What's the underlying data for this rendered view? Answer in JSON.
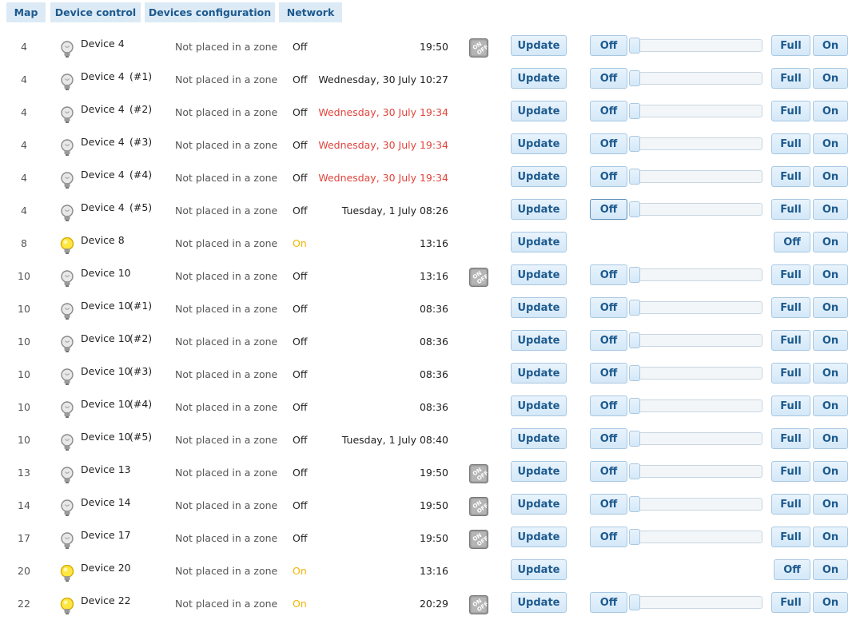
{
  "tabs": [
    "Map",
    "Device control",
    "Devices configuration",
    "Network"
  ],
  "buttons": {
    "update": "Update",
    "off": "Off",
    "full": "Full",
    "on": "On"
  },
  "colors": {
    "accent": "#1d5a8e",
    "tab_bg": "#dceaf6",
    "alert": "#e0453c",
    "on_state": "#f2b400"
  },
  "devices": [
    {
      "id": "4",
      "bulb": "bulb-off-icon",
      "name": "Device 4",
      "suffix": "",
      "zone": "Not placed in a zone",
      "state": "Off",
      "time": "19:50",
      "time_alert": false,
      "onoff_icon": true,
      "controls": "dimmer",
      "off_active": false
    },
    {
      "id": "4",
      "bulb": "bulb-off-icon",
      "name": "Device 4",
      "suffix": "(#1)",
      "zone": "Not placed in a zone",
      "state": "Off",
      "time": "Wednesday, 30 July 10:27",
      "time_alert": false,
      "onoff_icon": false,
      "controls": "dimmer",
      "off_active": false
    },
    {
      "id": "4",
      "bulb": "bulb-off-icon",
      "name": "Device 4",
      "suffix": "(#2)",
      "zone": "Not placed in a zone",
      "state": "Off",
      "time": "Wednesday, 30 July 19:34",
      "time_alert": true,
      "onoff_icon": false,
      "controls": "dimmer",
      "off_active": false
    },
    {
      "id": "4",
      "bulb": "bulb-off-icon",
      "name": "Device 4",
      "suffix": "(#3)",
      "zone": "Not placed in a zone",
      "state": "Off",
      "time": "Wednesday, 30 July 19:34",
      "time_alert": true,
      "onoff_icon": false,
      "controls": "dimmer",
      "off_active": false
    },
    {
      "id": "4",
      "bulb": "bulb-off-icon",
      "name": "Device 4",
      "suffix": "(#4)",
      "zone": "Not placed in a zone",
      "state": "Off",
      "time": "Wednesday, 30 July 19:34",
      "time_alert": true,
      "onoff_icon": false,
      "controls": "dimmer",
      "off_active": false
    },
    {
      "id": "4",
      "bulb": "bulb-off-icon",
      "name": "Device 4",
      "suffix": "(#5)",
      "zone": "Not placed in a zone",
      "state": "Off",
      "time": "Tuesday, 1 July 08:26",
      "time_alert": false,
      "onoff_icon": false,
      "controls": "dimmer",
      "off_active": true
    },
    {
      "id": "8",
      "bulb": "bulb-on-icon",
      "name": "Device 8",
      "suffix": "",
      "zone": "Not placed in a zone",
      "state": "On",
      "time": "13:16",
      "time_alert": false,
      "onoff_icon": false,
      "controls": "switch",
      "off_active": false
    },
    {
      "id": "10",
      "bulb": "bulb-off-icon",
      "name": "Device 10",
      "suffix": "",
      "zone": "Not placed in a zone",
      "state": "Off",
      "time": "13:16",
      "time_alert": false,
      "onoff_icon": true,
      "controls": "dimmer",
      "off_active": false
    },
    {
      "id": "10",
      "bulb": "bulb-off-icon",
      "name": "Device 10",
      "suffix": "(#1)",
      "zone": "Not placed in a zone",
      "state": "Off",
      "time": "08:36",
      "time_alert": false,
      "onoff_icon": false,
      "controls": "dimmer",
      "off_active": false
    },
    {
      "id": "10",
      "bulb": "bulb-off-icon",
      "name": "Device 10",
      "suffix": "(#2)",
      "zone": "Not placed in a zone",
      "state": "Off",
      "time": "08:36",
      "time_alert": false,
      "onoff_icon": false,
      "controls": "dimmer",
      "off_active": false
    },
    {
      "id": "10",
      "bulb": "bulb-off-icon",
      "name": "Device 10",
      "suffix": "(#3)",
      "zone": "Not placed in a zone",
      "state": "Off",
      "time": "08:36",
      "time_alert": false,
      "onoff_icon": false,
      "controls": "dimmer",
      "off_active": false
    },
    {
      "id": "10",
      "bulb": "bulb-off-icon",
      "name": "Device 10",
      "suffix": "(#4)",
      "zone": "Not placed in a zone",
      "state": "Off",
      "time": "08:36",
      "time_alert": false,
      "onoff_icon": false,
      "controls": "dimmer",
      "off_active": false
    },
    {
      "id": "10",
      "bulb": "bulb-off-icon",
      "name": "Device 10",
      "suffix": "(#5)",
      "zone": "Not placed in a zone",
      "state": "Off",
      "time": "Tuesday, 1 July 08:40",
      "time_alert": false,
      "onoff_icon": false,
      "controls": "dimmer",
      "off_active": false
    },
    {
      "id": "13",
      "bulb": "bulb-off-icon",
      "name": "Device 13",
      "suffix": "",
      "zone": "Not placed in a zone",
      "state": "Off",
      "time": "19:50",
      "time_alert": false,
      "onoff_icon": true,
      "controls": "dimmer",
      "off_active": false
    },
    {
      "id": "14",
      "bulb": "bulb-off-icon",
      "name": "Device 14",
      "suffix": "",
      "zone": "Not placed in a zone",
      "state": "Off",
      "time": "19:50",
      "time_alert": false,
      "onoff_icon": true,
      "controls": "dimmer",
      "off_active": false
    },
    {
      "id": "17",
      "bulb": "bulb-off-icon",
      "name": "Device 17",
      "suffix": "",
      "zone": "Not placed in a zone",
      "state": "Off",
      "time": "19:50",
      "time_alert": false,
      "onoff_icon": true,
      "controls": "dimmer",
      "off_active": false
    },
    {
      "id": "20",
      "bulb": "bulb-on-icon",
      "name": "Device 20",
      "suffix": "",
      "zone": "Not placed in a zone",
      "state": "On",
      "time": "13:16",
      "time_alert": false,
      "onoff_icon": false,
      "controls": "switch",
      "off_active": false
    },
    {
      "id": "22",
      "bulb": "bulb-on-icon",
      "name": "Device 22",
      "suffix": "",
      "zone": "Not placed in a zone",
      "state": "On",
      "time": "20:29",
      "time_alert": false,
      "onoff_icon": true,
      "controls": "dimmer",
      "off_active": false
    }
  ]
}
